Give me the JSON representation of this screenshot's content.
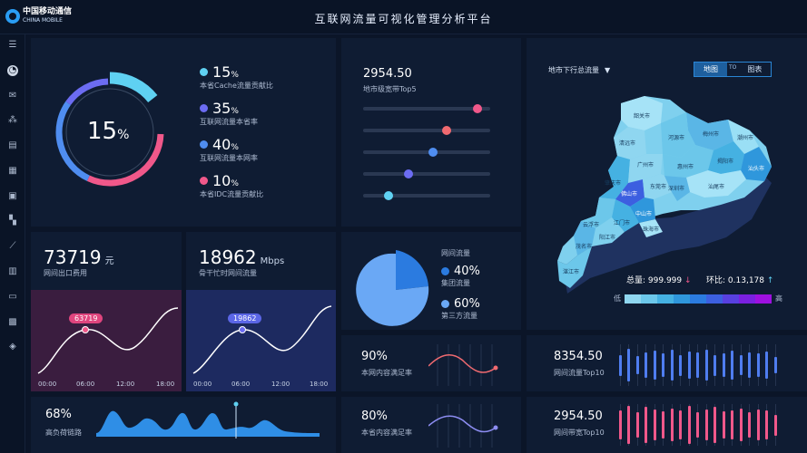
{
  "header": {
    "logo_cn": "中国移动通信",
    "logo_en": "CHINA MOBILE",
    "title": "互联网流量可视化管理分析平台"
  },
  "sidebar": {
    "items": [
      {
        "icon": "menu-icon"
      },
      {
        "icon": "dashboard-icon",
        "active": true
      },
      {
        "icon": "mail-icon"
      },
      {
        "icon": "share-icon"
      },
      {
        "icon": "document-icon"
      },
      {
        "icon": "grid-icon"
      },
      {
        "icon": "image-icon"
      },
      {
        "icon": "apps-icon"
      },
      {
        "icon": "brush-icon"
      },
      {
        "icon": "map-icon"
      },
      {
        "icon": "book-icon"
      },
      {
        "icon": "calendar-icon"
      },
      {
        "icon": "layers-icon"
      }
    ]
  },
  "donut": {
    "center_value": "15",
    "center_unit": "%",
    "legend": [
      {
        "value": "15",
        "unit": "%",
        "label": "本省Cache流量贡献比",
        "color": "#5fd1f2"
      },
      {
        "value": "35",
        "unit": "%",
        "label": "互联网流量本省率",
        "color": "#6c6cf2"
      },
      {
        "value": "40",
        "unit": "%",
        "label": "互联网流量本网率",
        "color": "#4f8df0"
      },
      {
        "value": "10",
        "unit": "%",
        "label": "本省IDC流量贡献比",
        "color": "#f0588a"
      }
    ]
  },
  "sliders": {
    "value": "2954.50",
    "label": "地市级宽带Top5",
    "items": [
      {
        "level": 0.9,
        "color": "#f0588a"
      },
      {
        "level": 0.66,
        "color": "#f06a70"
      },
      {
        "level": 0.55,
        "color": "#4f8df0"
      },
      {
        "level": 0.36,
        "color": "#6c6cf2"
      },
      {
        "level": 0.2,
        "color": "#5fd1f2"
      }
    ]
  },
  "map": {
    "dropdown": "地市下行总流量",
    "toggle_map": "地图",
    "toggle_chart": "图表",
    "toggle_middle": "TO",
    "total_label": "总量:",
    "total_value": "999.999",
    "ratio_label": "环比:",
    "ratio_value": "0.13,178",
    "legend_low": "低",
    "legend_high": "高",
    "legend_colors": [
      "#8fd6f0",
      "#6cc7ea",
      "#45b1e2",
      "#2f97dc",
      "#2b7be0",
      "#3c5fe0",
      "#5840e0",
      "#7a20e0",
      "#9e10e0"
    ],
    "cities": [
      "韶关市",
      "梅州市",
      "清远市",
      "河源市",
      "潮州市",
      "肇庆市",
      "广州市",
      "惠州市",
      "揭阳市",
      "汕头市",
      "云浮市",
      "佛山市",
      "东莞市",
      "汕尾市",
      "深圳市",
      "江门市",
      "中山市",
      "阳江市",
      "茂名市",
      "湛江市",
      "珠海市"
    ]
  },
  "export_fee": {
    "value": "73719",
    "unit": "元",
    "label": "网间出口费用",
    "badge": "63719",
    "times": [
      "00:00",
      "06:00",
      "12:00",
      "18:00"
    ]
  },
  "backbone": {
    "value": "18962",
    "unit": "Mbps",
    "label": "骨干忙时网间流量",
    "badge": "19862",
    "times": [
      "00:00",
      "06:00",
      "12:00",
      "18:00"
    ]
  },
  "pie": {
    "title": "网间流量",
    "items": [
      {
        "value": "40%",
        "label": "集团流量",
        "color": "#2b7be0"
      },
      {
        "value": "60%",
        "label": "第三方流量",
        "color": "#6aa8f5"
      }
    ]
  },
  "satisfy_net": {
    "value": "90%",
    "label": "本网内容满足率"
  },
  "satisfy_province": {
    "value": "80%",
    "label": "本省内容满足率"
  },
  "top10_traffic": {
    "value": "8354.50",
    "label": "网间流量Top10"
  },
  "top10_bandwidth": {
    "value": "2954.50",
    "label": "网间带宽Top10"
  },
  "high_load": {
    "value": "68%",
    "label": "高负荷链路"
  }
}
